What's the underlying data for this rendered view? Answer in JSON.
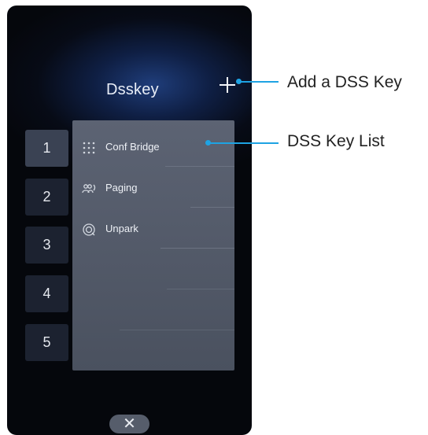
{
  "screen": {
    "title": "Dsskey",
    "tabs": [
      {
        "label": "1",
        "active": true
      },
      {
        "label": "2",
        "active": false
      },
      {
        "label": "3",
        "active": false
      },
      {
        "label": "4",
        "active": false
      },
      {
        "label": "5",
        "active": false
      }
    ],
    "items": [
      {
        "label": "Conf Bridge",
        "icon": "dialpad-grid-icon"
      },
      {
        "label": "Paging",
        "icon": "paging-icon"
      },
      {
        "label": "Unpark",
        "icon": "unpark-icon"
      }
    ],
    "close_glyph": "✕"
  },
  "callouts": {
    "add": "Add a DSS Key",
    "list": "DSS Key List"
  },
  "colors": {
    "accent": "#1ea3e3",
    "panel": "#555c6a",
    "background": "#070b16"
  }
}
